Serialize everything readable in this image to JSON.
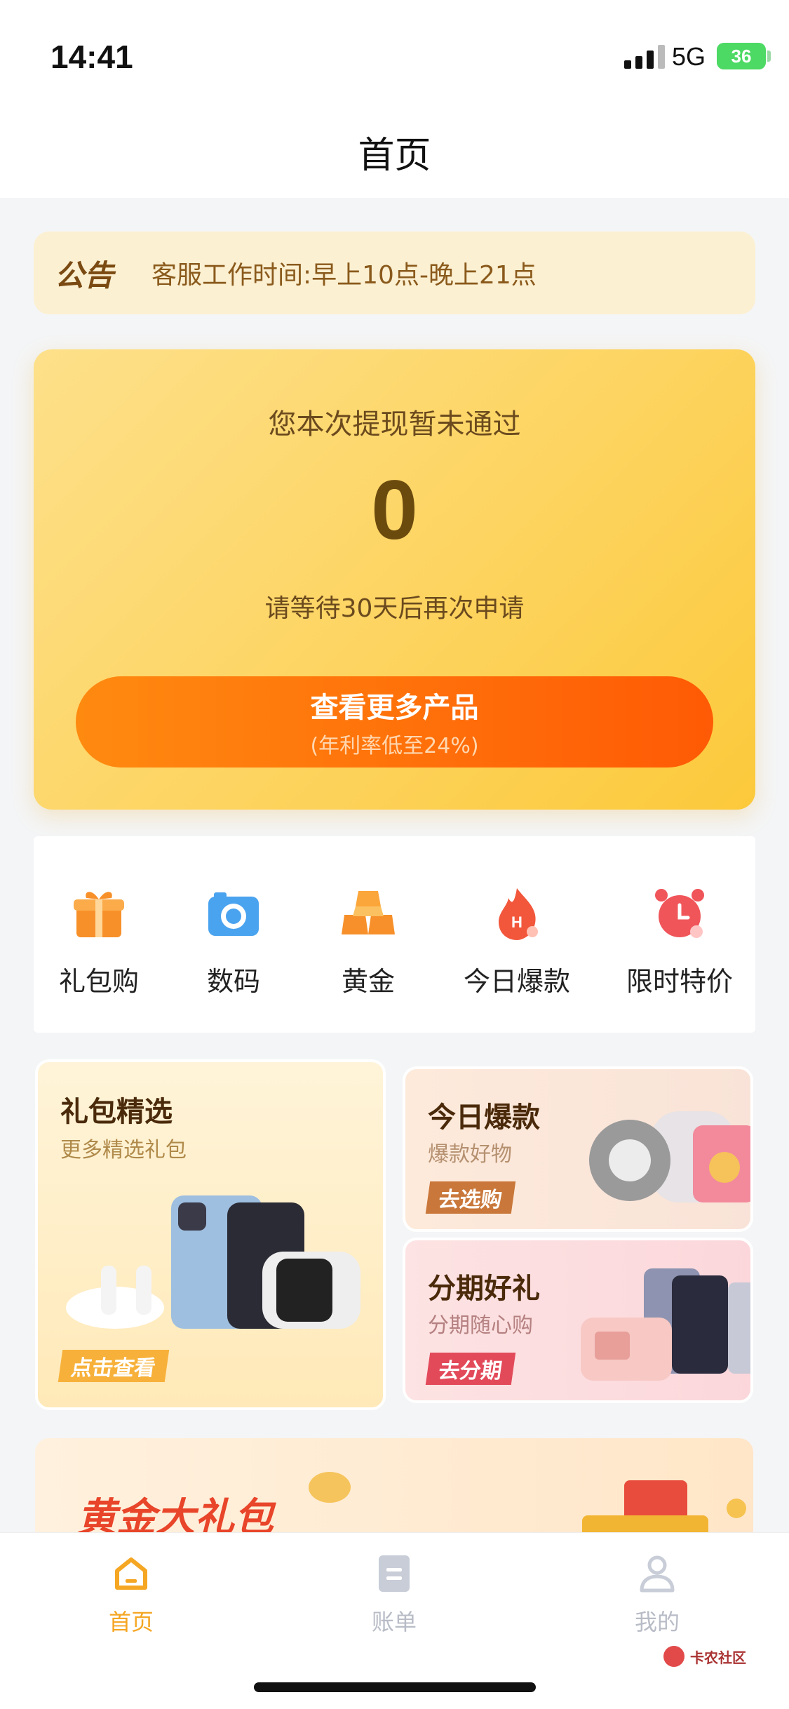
{
  "status_bar": {
    "time": "14:41",
    "network": "5G",
    "battery": "36"
  },
  "nav": {
    "title": "首页"
  },
  "notice": {
    "tag": "公告",
    "text": "客服工作时间:早上10点-晚上21点"
  },
  "hero": {
    "message": "您本次提现暂未通过",
    "amount": "0",
    "sub": "请等待30天后再次申请",
    "button_label": "查看更多产品",
    "button_sub": "(年利率低至24%)"
  },
  "categories": [
    {
      "label": "礼包购",
      "icon": "gift-icon"
    },
    {
      "label": "数码",
      "icon": "camera-icon"
    },
    {
      "label": "黄金",
      "icon": "gold-bar-icon"
    },
    {
      "label": "今日爆款",
      "icon": "flame-icon"
    },
    {
      "label": "限时特价",
      "icon": "alarm-clock-icon"
    }
  ],
  "promos": {
    "gift": {
      "title": "礼包精选",
      "sub": "更多精选礼包",
      "button": "点击查看"
    },
    "today": {
      "title": "今日爆款",
      "sub": "爆款好物",
      "button": "去选购"
    },
    "install": {
      "title": "分期好礼",
      "sub": "分期随心购",
      "button": "去分期"
    }
  },
  "gold_banner": {
    "title": "黄金大礼包"
  },
  "tabs": [
    {
      "label": "首页",
      "icon": "home-icon",
      "active": true
    },
    {
      "label": "账单",
      "icon": "bill-icon",
      "active": false
    },
    {
      "label": "我的",
      "icon": "user-icon",
      "active": false
    }
  ],
  "watermark": {
    "text": "卡农社区"
  },
  "colors": {
    "accent": "#f5a623",
    "button_start": "#ff8a10",
    "button_end": "#ff5a05",
    "hero_bg": "#fdd564"
  }
}
